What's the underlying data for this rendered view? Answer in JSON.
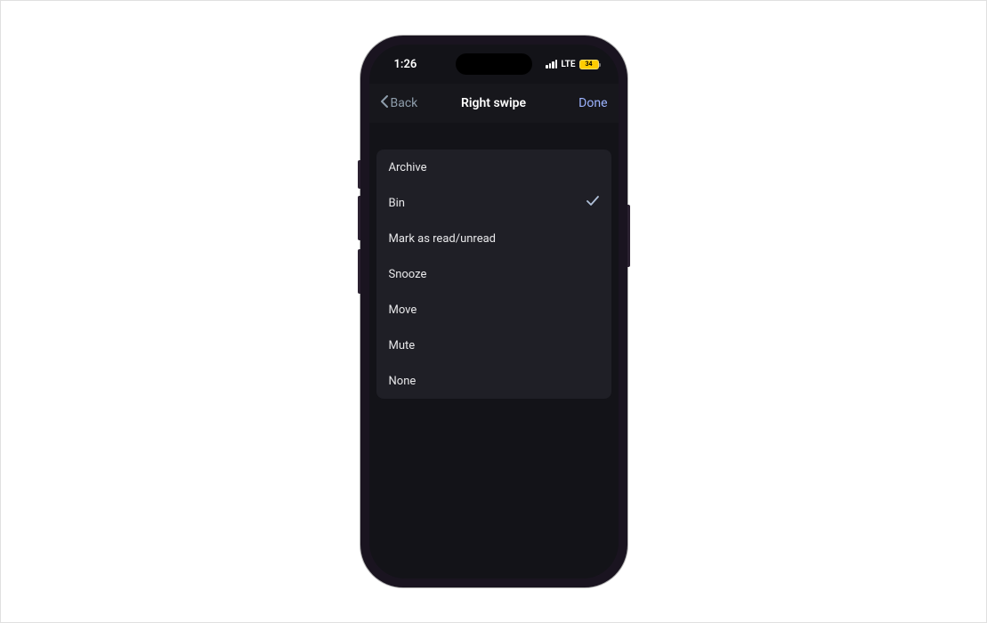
{
  "status_bar": {
    "time": "1:26",
    "network_type": "LTE",
    "battery_percent": "34"
  },
  "nav": {
    "back_label": "Back",
    "title": "Right swipe",
    "done_label": "Done"
  },
  "options": [
    {
      "label": "Archive",
      "selected": false
    },
    {
      "label": "Bin",
      "selected": true
    },
    {
      "label": "Mark as read/unread",
      "selected": false
    },
    {
      "label": "Snooze",
      "selected": false
    },
    {
      "label": "Move",
      "selected": false
    },
    {
      "label": "Mute",
      "selected": false
    },
    {
      "label": "None",
      "selected": false
    }
  ]
}
